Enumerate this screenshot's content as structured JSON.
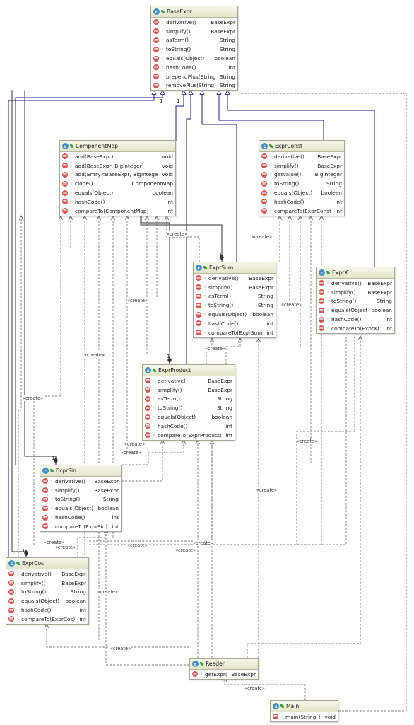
{
  "colors": {
    "header_top": "#f7f7ea",
    "header_bottom": "#e3e3c8",
    "class_icon": "#3f8fcf",
    "method_icon": "#d9534f",
    "visibility": "#3aa13a",
    "inheritance_line": "#1a1a8c",
    "dependency_line": "#555555"
  },
  "icons": {
    "class": "class-icon",
    "method": "method-icon",
    "visibility": "public-leaf-icon"
  },
  "stereotype": "«create»",
  "multiplicity": "1",
  "classes": [
    {
      "id": "BaseExpr",
      "name": "BaseExpr",
      "methods": [
        {
          "name": "derivative()",
          "ret": "BaseExpr"
        },
        {
          "name": "simplify()",
          "ret": "BaseExpr"
        },
        {
          "name": "asTerm()",
          "ret": "String"
        },
        {
          "name": "toString()",
          "ret": "String"
        },
        {
          "name": "equals(Object)",
          "ret": "boolean"
        },
        {
          "name": "hashCode()",
          "ret": "int"
        },
        {
          "name": "prependPlus(String)",
          "ret": "String"
        },
        {
          "name": "removePlus(String)",
          "ret": "String"
        }
      ]
    },
    {
      "id": "ComponentMap",
      "name": "ComponentMap",
      "methods": [
        {
          "name": "add(BaseExpr)",
          "ret": "void"
        },
        {
          "name": "add(BaseExpr, BigInteger)",
          "ret": "void"
        },
        {
          "name": "add(Entry<BaseExpr, BigInteger>)",
          "ret": "void"
        },
        {
          "name": "clone()",
          "ret": "ComponentMap"
        },
        {
          "name": "equals(Object)",
          "ret": "boolean"
        },
        {
          "name": "hashCode()",
          "ret": "int"
        },
        {
          "name": "compareTo(ComponentMap)",
          "ret": "int"
        }
      ]
    },
    {
      "id": "ExprConst",
      "name": "ExprConst",
      "methods": [
        {
          "name": "derivative()",
          "ret": "BaseExpr"
        },
        {
          "name": "simplify()",
          "ret": "BaseExpr"
        },
        {
          "name": "getValue()",
          "ret": "BigInteger"
        },
        {
          "name": "toString()",
          "ret": "String"
        },
        {
          "name": "equals(Object)",
          "ret": "boolean"
        },
        {
          "name": "hashCode()",
          "ret": "int"
        },
        {
          "name": "compareTo(ExprConst)",
          "ret": "int"
        }
      ]
    },
    {
      "id": "ExprSum",
      "name": "ExprSum",
      "methods": [
        {
          "name": "derivative()",
          "ret": "BaseExpr"
        },
        {
          "name": "simplify()",
          "ret": "BaseExpr"
        },
        {
          "name": "asTerm()",
          "ret": "String"
        },
        {
          "name": "toString()",
          "ret": "String"
        },
        {
          "name": "equals(Object)",
          "ret": "boolean"
        },
        {
          "name": "hashCode()",
          "ret": "int"
        },
        {
          "name": "compareTo(ExprSum)",
          "ret": "int"
        }
      ]
    },
    {
      "id": "ExprX",
      "name": "ExprX",
      "methods": [
        {
          "name": "derivative()",
          "ret": "BaseExpr"
        },
        {
          "name": "simplify()",
          "ret": "BaseExpr"
        },
        {
          "name": "toString()",
          "ret": "String"
        },
        {
          "name": "equals(Object)",
          "ret": "boolean"
        },
        {
          "name": "hashCode()",
          "ret": "int"
        },
        {
          "name": "compareTo(ExprX)",
          "ret": "int"
        }
      ]
    },
    {
      "id": "ExprProduct",
      "name": "ExprProduct",
      "methods": [
        {
          "name": "derivative()",
          "ret": "BaseExpr"
        },
        {
          "name": "simplify()",
          "ret": "BaseExpr"
        },
        {
          "name": "asTerm()",
          "ret": "String"
        },
        {
          "name": "toString()",
          "ret": "String"
        },
        {
          "name": "equals(Object)",
          "ret": "boolean"
        },
        {
          "name": "hashCode()",
          "ret": "int"
        },
        {
          "name": "compareTo(ExprProduct)",
          "ret": "int"
        }
      ]
    },
    {
      "id": "ExprSin",
      "name": "ExprSin",
      "methods": [
        {
          "name": "derivative()",
          "ret": "BaseExpr"
        },
        {
          "name": "simplify()",
          "ret": "BaseExpr"
        },
        {
          "name": "toString()",
          "ret": "String"
        },
        {
          "name": "equals(Object)",
          "ret": "boolean"
        },
        {
          "name": "hashCode()",
          "ret": "int"
        },
        {
          "name": "compareTo(ExprSin)",
          "ret": "int"
        }
      ]
    },
    {
      "id": "ExprCos",
      "name": "ExprCos",
      "methods": [
        {
          "name": "derivative()",
          "ret": "BaseExpr"
        },
        {
          "name": "simplify()",
          "ret": "BaseExpr"
        },
        {
          "name": "toString()",
          "ret": "String"
        },
        {
          "name": "equals(Object)",
          "ret": "boolean"
        },
        {
          "name": "hashCode()",
          "ret": "int"
        },
        {
          "name": "compareTo(ExprCos)",
          "ret": "int"
        }
      ]
    },
    {
      "id": "Reader",
      "name": "Reader",
      "methods": [
        {
          "name": "getExpr()",
          "ret": "BaseExpr"
        }
      ]
    },
    {
      "id": "Main",
      "name": "Main",
      "methods": [
        {
          "name": "main(String[])",
          "ret": "void"
        }
      ]
    }
  ],
  "relations": [
    {
      "from": "ComponentMap",
      "to": "BaseExpr",
      "kind": "inherit"
    },
    {
      "from": "ExprConst",
      "to": "BaseExpr",
      "kind": "inherit"
    },
    {
      "from": "ExprSum",
      "to": "BaseExpr",
      "kind": "inherit"
    },
    {
      "from": "ExprX",
      "to": "BaseExpr",
      "kind": "inherit"
    },
    {
      "from": "ExprProduct",
      "to": "BaseExpr",
      "kind": "inherit"
    },
    {
      "from": "ExprSin",
      "to": "BaseExpr",
      "kind": "inherit"
    },
    {
      "from": "ExprCos",
      "to": "BaseExpr",
      "kind": "inherit"
    },
    {
      "from": "ExprSin",
      "to": "BaseExpr",
      "kind": "composition"
    },
    {
      "from": "ExprCos",
      "to": "BaseExpr",
      "kind": "composition"
    },
    {
      "from": "ExprSum",
      "to": "ComponentMap",
      "kind": "composition"
    },
    {
      "from": "ExprProduct",
      "to": "ComponentMap",
      "kind": "composition"
    },
    {
      "from": "ExprSum",
      "to": "ExprConst",
      "kind": "create"
    },
    {
      "from": "ComponentMap",
      "to": "ExprConst",
      "kind": "create"
    },
    {
      "from": "ExprProduct",
      "to": "ExprSum",
      "kind": "create"
    },
    {
      "from": "ExprSin",
      "to": "ExprProduct",
      "kind": "create"
    },
    {
      "from": "ExprCos",
      "to": "ExprSin",
      "kind": "create"
    },
    {
      "from": "Reader",
      "to": "ExprCos",
      "kind": "create"
    },
    {
      "from": "Main",
      "to": "Reader",
      "kind": "create"
    }
  ],
  "labels": [
    {
      "id": "create-sum-const",
      "text": "«create»"
    },
    {
      "id": "create-map-sum",
      "text": "«create»"
    },
    {
      "id": "create-mid-left",
      "text": "«create»"
    },
    {
      "id": "create-left",
      "text": "«create»"
    },
    {
      "id": "create-far-left",
      "text": "«create»"
    },
    {
      "id": "create-x",
      "text": "«create»"
    },
    {
      "id": "create-sum-prod",
      "text": "«create»"
    },
    {
      "id": "create-prod-sin-1",
      "text": "«create»"
    },
    {
      "id": "create-prod-sin-2",
      "text": "«create»"
    },
    {
      "id": "create-right-mid",
      "text": "«create»"
    },
    {
      "id": "create-reader-mid",
      "text": "«create»"
    },
    {
      "id": "create-cos-1",
      "text": "«create»"
    },
    {
      "id": "create-cos-2",
      "text": "«create»"
    },
    {
      "id": "create-cos-3",
      "text": "«create»"
    },
    {
      "id": "create-cos-4",
      "text": "«create»"
    },
    {
      "id": "create-cos-5",
      "text": "«create»"
    },
    {
      "id": "create-reader-left",
      "text": "«create»"
    },
    {
      "id": "create-reader-cos",
      "text": "«create»"
    },
    {
      "id": "create-main-reader",
      "text": "«create»"
    }
  ]
}
